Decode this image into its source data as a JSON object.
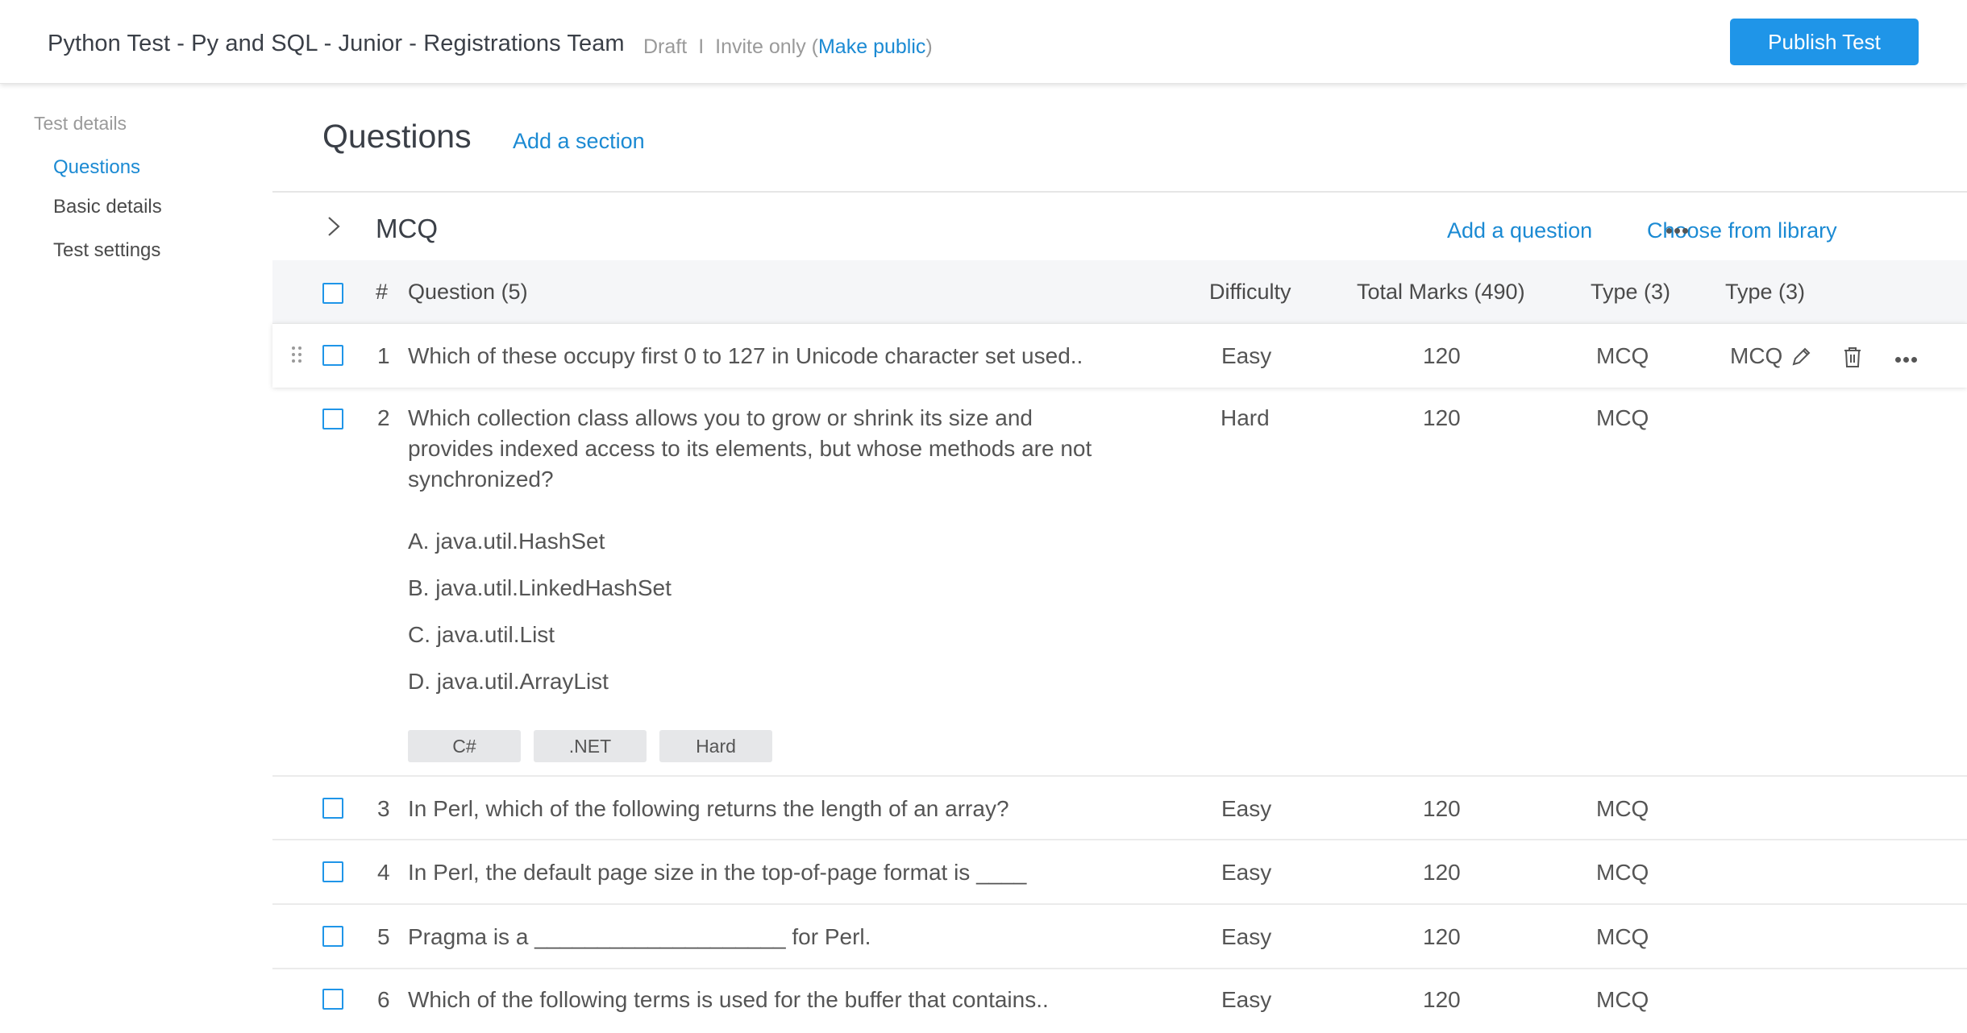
{
  "header": {
    "title": "Python Test - Py and SQL - Junior - Registrations Team",
    "status": "Draft",
    "separator": "I",
    "invite_prefix": "Invite only (",
    "make_public": "Make public",
    "invite_suffix": ")",
    "publish_label": "Publish Test"
  },
  "sidebar": {
    "heading": "Test details",
    "items": [
      {
        "label": "Questions",
        "active": true
      },
      {
        "label": "Basic details",
        "active": false
      },
      {
        "label": "Test settings",
        "active": false
      }
    ]
  },
  "main": {
    "title": "Questions",
    "add_section": "Add a section",
    "section": {
      "name": "MCQ",
      "add_question": "Add a question",
      "choose_library": "Choose from library"
    },
    "table": {
      "headers": {
        "num": "#",
        "question": "Question (5)",
        "difficulty": "Difficulty",
        "marks": "Total Marks (490)",
        "type1": "Type (3)",
        "type2": "Type (3)"
      },
      "rows": [
        {
          "num": "1",
          "question": "Which of these occupy first 0 to 127 in Unicode character set used..",
          "difficulty": "Easy",
          "marks": "120",
          "type": "MCQ",
          "type2": "MCQ"
        },
        {
          "num": "2",
          "question_lines": [
            "Which collection class allows you to grow or shrink its size and",
            "provides indexed access to its elements, but whose methods are not",
            "synchronized?"
          ],
          "difficulty": "Hard",
          "marks": "120",
          "type": "MCQ",
          "options": [
            "A. java.util.HashSet",
            "B. java.util.LinkedHashSet",
            "C. java.util.List",
            "D. java.util.ArrayList"
          ],
          "tags": [
            "C#",
            ".NET",
            "Hard"
          ]
        },
        {
          "num": "3",
          "question": "In Perl, which of the following returns the length of an array?",
          "difficulty": "Easy",
          "marks": "120",
          "type": "MCQ"
        },
        {
          "num": "4",
          "question": "In Perl, the default page size in the top-of-page format is ____",
          "difficulty": "Easy",
          "marks": "120",
          "type": "MCQ"
        },
        {
          "num": "5",
          "question": "Pragma is a ____________________ for Perl.",
          "difficulty": "Easy",
          "marks": "120",
          "type": "MCQ"
        },
        {
          "num": "6",
          "question": "Which of the following terms is used for the buffer that contains..",
          "difficulty": "Easy",
          "marks": "120",
          "type": "MCQ"
        }
      ]
    }
  },
  "colors": {
    "accent": "#1f95e8",
    "link": "#1b8ad3",
    "text": "#4a4a4a",
    "header_bg": "#f5f6f8"
  },
  "icons": [
    "chevron-right-icon",
    "more-horizontal-icon",
    "drag-handle-icon",
    "pencil-icon",
    "trash-icon"
  ]
}
